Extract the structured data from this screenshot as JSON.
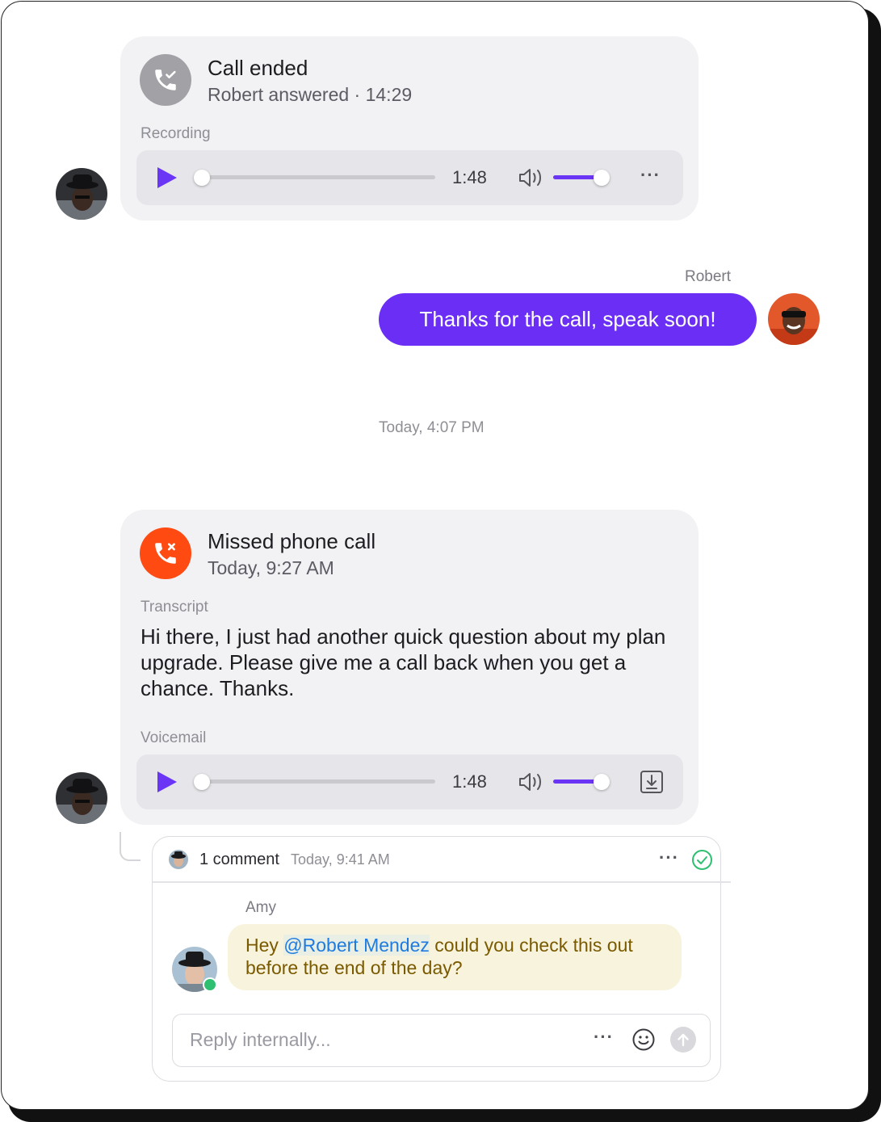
{
  "call_ended": {
    "title": "Call ended",
    "subtitle": "Robert answered · 14:29",
    "section_label": "Recording",
    "duration": "1:48",
    "more_label": "···",
    "icon": "phone-check-icon"
  },
  "outgoing": {
    "sender": "Robert",
    "message": "Thanks for the call, speak soon!"
  },
  "divider_timestamp": "Today, 4:07 PM",
  "missed_call": {
    "title": "Missed phone call",
    "subtitle": "Today, 9:27 AM",
    "transcript_label": "Transcript",
    "transcript": "Hi there, I just had another quick question about my plan upgrade. Please give me a call back when you get a chance. Thanks.",
    "voicemail_label": "Voicemail",
    "duration": "1:48",
    "icon": "phone-missed-icon"
  },
  "comments": {
    "count_label": "1 comment",
    "timestamp": "Today, 9:41 AM",
    "more_label": "···",
    "author": "Amy",
    "mention": "@Robert Mendez",
    "text_before": "Hey ",
    "text_after": " could you check this out before the end of the day?",
    "reply_placeholder": "Reply internally...",
    "reply_more_label": "···"
  },
  "colors": {
    "accent": "#6b2ef5",
    "missed": "#ff4a12",
    "resolved": "#2fbf71",
    "online": "#2fbf71"
  },
  "player_progress": {
    "recording": 0.0,
    "voicemail": 0.0,
    "volume": 0.85
  }
}
